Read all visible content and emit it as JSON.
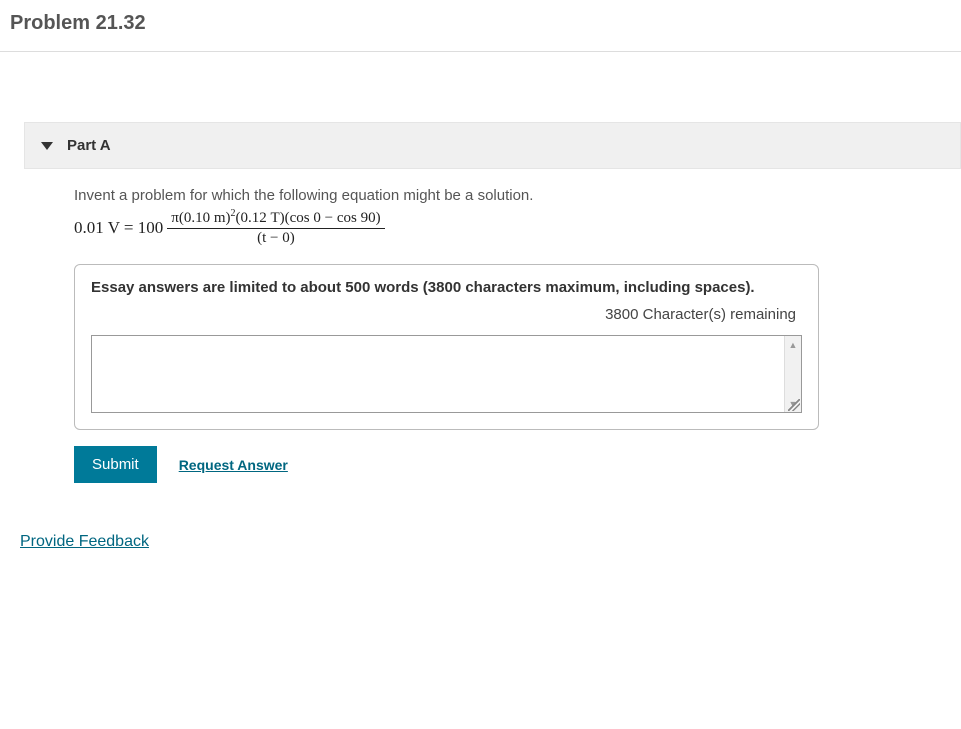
{
  "page": {
    "title": "Problem 21.32"
  },
  "part": {
    "label": "Part A",
    "prompt": "Invent a problem for which the following equation might be a solution.",
    "equation": {
      "lhs": "0.01 V = 100",
      "num_prefix": "π(0.10 m)",
      "num_exp": "2",
      "num_suffix": "(0.12 T)(cos  0 − cos  90)",
      "den": "(t − 0)"
    }
  },
  "essay": {
    "notice": "Essay answers are limited to about 500 words (3800 characters maximum, including spaces).",
    "remaining": "3800 Character(s) remaining",
    "value": ""
  },
  "actions": {
    "submit": "Submit",
    "request": "Request Answer"
  },
  "footer": {
    "feedback": "Provide Feedback"
  }
}
